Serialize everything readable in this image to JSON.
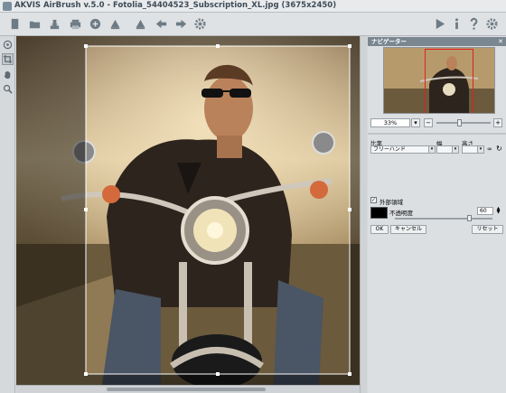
{
  "window": {
    "title": "AKVIS AirBrush v.5.0 - Fotolia_54404523_Subscription_XL.jpg (3675x2450)"
  },
  "toolbar": {
    "left_icons": [
      "open-icon",
      "save-icon",
      "print-icon",
      "share-icon",
      "bookmark-icon",
      "brush-icon",
      "back-arrow-icon",
      "forward-arrow-icon",
      "settings-gear-icon"
    ],
    "right_icons": [
      "run-icon",
      "info-icon",
      "help-icon",
      "preferences-icon"
    ]
  },
  "left_tools": [
    "crop-icon",
    "hand-icon",
    "zoom-icon"
  ],
  "navigator": {
    "title": "ナビゲーター",
    "zoom": "33%",
    "zoom_minus": "−",
    "zoom_plus": "+"
  },
  "crop": {
    "ratio_label": "比率",
    "width_label": "幅",
    "height_label": "高さ",
    "ratio_value": "フリーハンド",
    "outer_area_label": "外部領域",
    "outer_area_checked": true,
    "opacity_label": "不透明度",
    "opacity_value": "60",
    "ok": "OK",
    "cancel": "キャンセル",
    "reset": "リセット"
  },
  "colors": {
    "title": "#3e4c57",
    "panel_header": "#7a8791",
    "swatch": "#000000"
  }
}
